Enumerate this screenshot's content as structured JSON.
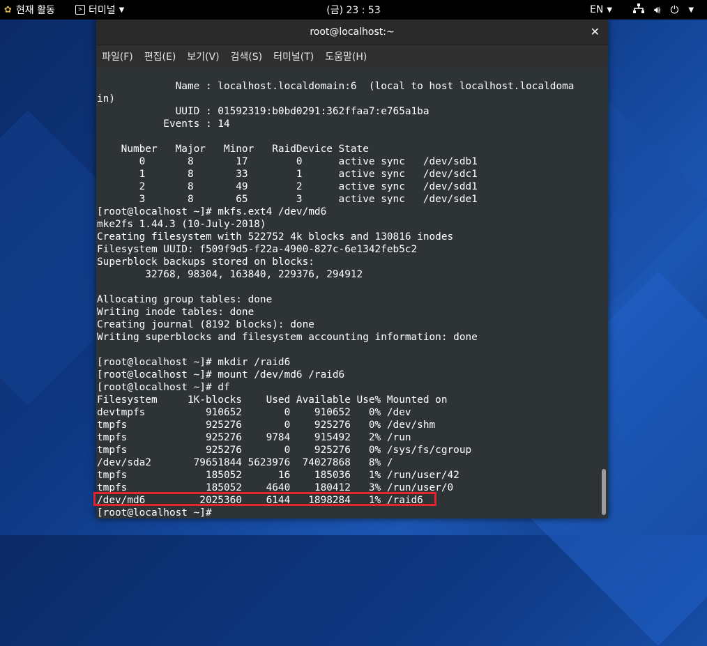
{
  "topbar": {
    "activities_label": "현재 활동",
    "terminal_menu_label": "터미널",
    "clock": "(금) 23 : 53",
    "language": "EN"
  },
  "window": {
    "title": "root@localhost:~"
  },
  "menu": [
    "파일(F)",
    "편집(E)",
    "보기(V)",
    "검색(S)",
    "터미널(T)",
    "도움말(H)"
  ],
  "terminal_lines": [
    "             Name : localhost.localdomain:6  (local to host localhost.localdoma",
    "in)",
    "             UUID : 01592319:b0bd0291:362ffaa7:e765a1ba",
    "           Events : 14",
    "",
    "    Number   Major   Minor   RaidDevice State",
    "       0       8       17        0      active sync   /dev/sdb1",
    "       1       8       33        1      active sync   /dev/sdc1",
    "       2       8       49        2      active sync   /dev/sdd1",
    "       3       8       65        3      active sync   /dev/sde1",
    "[root@localhost ~]# mkfs.ext4 /dev/md6",
    "mke2fs 1.44.3 (10-July-2018)",
    "Creating filesystem with 522752 4k blocks and 130816 inodes",
    "Filesystem UUID: f509f9d5-f22a-4900-827c-6e1342feb5c2",
    "Superblock backups stored on blocks:",
    "        32768, 98304, 163840, 229376, 294912",
    "",
    "Allocating group tables: done",
    "Writing inode tables: done",
    "Creating journal (8192 blocks): done",
    "Writing superblocks and filesystem accounting information: done",
    "",
    "[root@localhost ~]# mkdir /raid6",
    "[root@localhost ~]# mount /dev/md6 /raid6",
    "[root@localhost ~]# df",
    "Filesystem     1K-blocks    Used Available Use% Mounted on",
    "devtmpfs          910652       0    910652   0% /dev",
    "tmpfs             925276       0    925276   0% /dev/shm",
    "tmpfs             925276    9784    915492   2% /run",
    "tmpfs             925276       0    925276   0% /sys/fs/cgroup",
    "/dev/sda2       79651844 5623976  74027868   8% /",
    "tmpfs             185052      16    185036   1% /run/user/42",
    "tmpfs             185052    4640    180412   3% /run/user/0",
    "/dev/md6         2025360    6144   1898284   1% /raid6",
    "[root@localhost ~]#"
  ],
  "colors": {
    "highlight": "#e3262d",
    "terminal_bg": "#2e3436"
  }
}
